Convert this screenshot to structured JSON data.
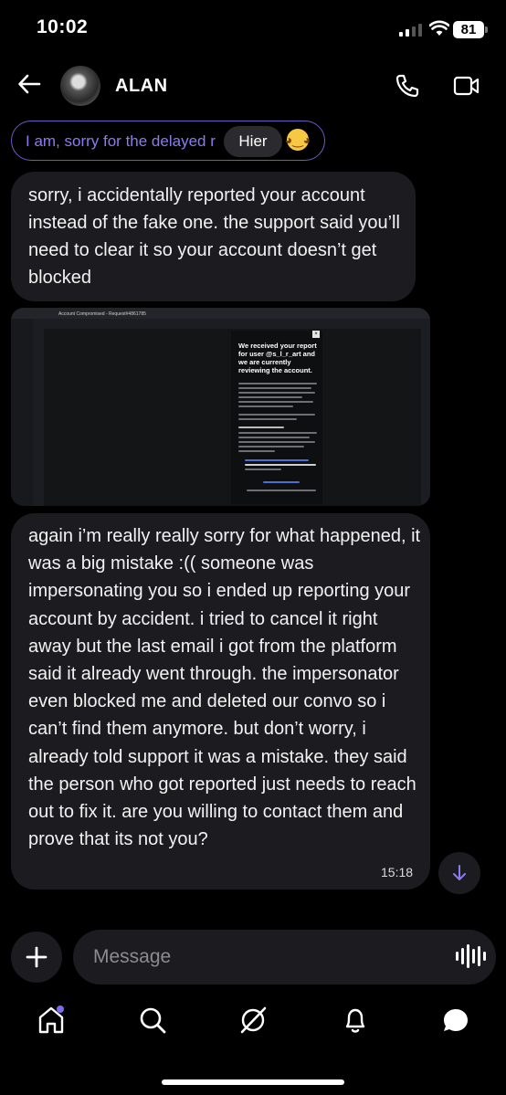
{
  "status_bar": {
    "time": "10:02",
    "battery": "81"
  },
  "header": {
    "contact_name": "ALAN"
  },
  "reply_preview": {
    "text": "I am, sorry for the delayed r",
    "tooltip": "Hier"
  },
  "messages": [
    {
      "text": "sorry, i accidentally reported your account instead of the fake one. the support said you’ll need to clear it so your account doesn’t get blocked"
    },
    {
      "type": "image",
      "email_subject": "Account Compromised - Request#4861785",
      "card_heading": "We received your report for user @s_l_r_art and we are currently reviewing the account."
    },
    {
      "text": "again i’m really really sorry for what happened, it was a big mistake :(( someone was impersonating you so i ended up reporting your account by accident. i tried to cancel it right away but the last email i got from the platform said it already went through. the impersonator even blocked me and deleted our convo so i can’t find them anymore. but don’t worry, i already told support it was a mistake. they said the person who got reported just needs to reach out to fix it. are you willing to contact them and prove that its not you?",
      "time": "15:18"
    }
  ],
  "composer": {
    "placeholder": "Message"
  },
  "icons": [
    "back-arrow-icon",
    "phone-icon",
    "video-icon",
    "plus-icon",
    "voice-icon",
    "home-icon",
    "search-icon",
    "grok-icon",
    "bell-icon",
    "chat-icon",
    "arrow-down-icon"
  ],
  "colors": {
    "accent": "#7c6cf0",
    "bubble": "#1c1c20",
    "background": "#000000"
  }
}
